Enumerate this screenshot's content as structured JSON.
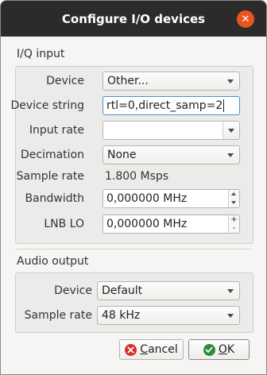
{
  "window": {
    "title": "Configure I/O devices"
  },
  "iq": {
    "section_title": "I/Q input",
    "device": {
      "label": "Device",
      "value": "Other..."
    },
    "device_string": {
      "label": "Device string",
      "value": "rtl=0,direct_samp=2"
    },
    "input_rate": {
      "label": "Input rate",
      "value": ""
    },
    "decimation": {
      "label": "Decimation",
      "value": "None"
    },
    "sample_rate": {
      "label": "Sample rate",
      "value": "1.800 Msps"
    },
    "bandwidth": {
      "label": "Bandwidth",
      "value": "0,000000 MHz"
    },
    "lnb_lo": {
      "label": "LNB LO",
      "value": "0,000000 MHz",
      "plus": "+",
      "minus": "-"
    }
  },
  "audio": {
    "section_title": "Audio output",
    "device": {
      "label": "Device",
      "value": "Default"
    },
    "sample_rate": {
      "label": "Sample rate",
      "value": "48 kHz"
    }
  },
  "buttons": {
    "cancel_mnemonic": "C",
    "cancel_rest": "ancel",
    "ok_mnemonic": "O",
    "ok_rest": "K"
  },
  "colors": {
    "titlebar": "#2b2b2b",
    "close": "#e95420",
    "cancel_icon": "#d7302a",
    "ok_icon": "#2e8b3a",
    "focus": "#4a90d9"
  },
  "icons": {
    "close": "close-icon",
    "cancel": "cancel-icon",
    "ok": "checkmark-icon"
  }
}
